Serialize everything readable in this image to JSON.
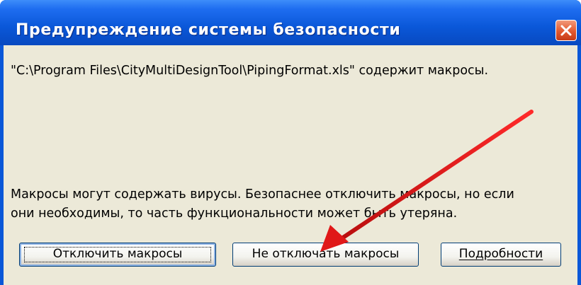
{
  "window": {
    "title": "Предупреждение системы безопасности",
    "close_icon": "close-icon"
  },
  "message": {
    "file_line": "\"C:\\Program Files\\CityMultiDesignTool\\PipingFormat.xls\" содержит макросы.",
    "warning_line1": "Макросы могут содержать вирусы. Безопаснее отключить макросы, но если",
    "warning_line2": "они необходимы, то часть функциональности может быть утеряна."
  },
  "buttons": {
    "disable_macros": "Отключить макросы",
    "enable_macros": "Не отключать макросы",
    "details": "Подробности"
  },
  "annotation": {
    "arrow_color": "#e01818",
    "arrow_icon": "red-arrow-annotation",
    "points_to": "Не отключать макросы"
  },
  "colors": {
    "title_bar": "#0a57d8",
    "dialog_background": "#ece9d8",
    "close_button": "#e2582f"
  }
}
